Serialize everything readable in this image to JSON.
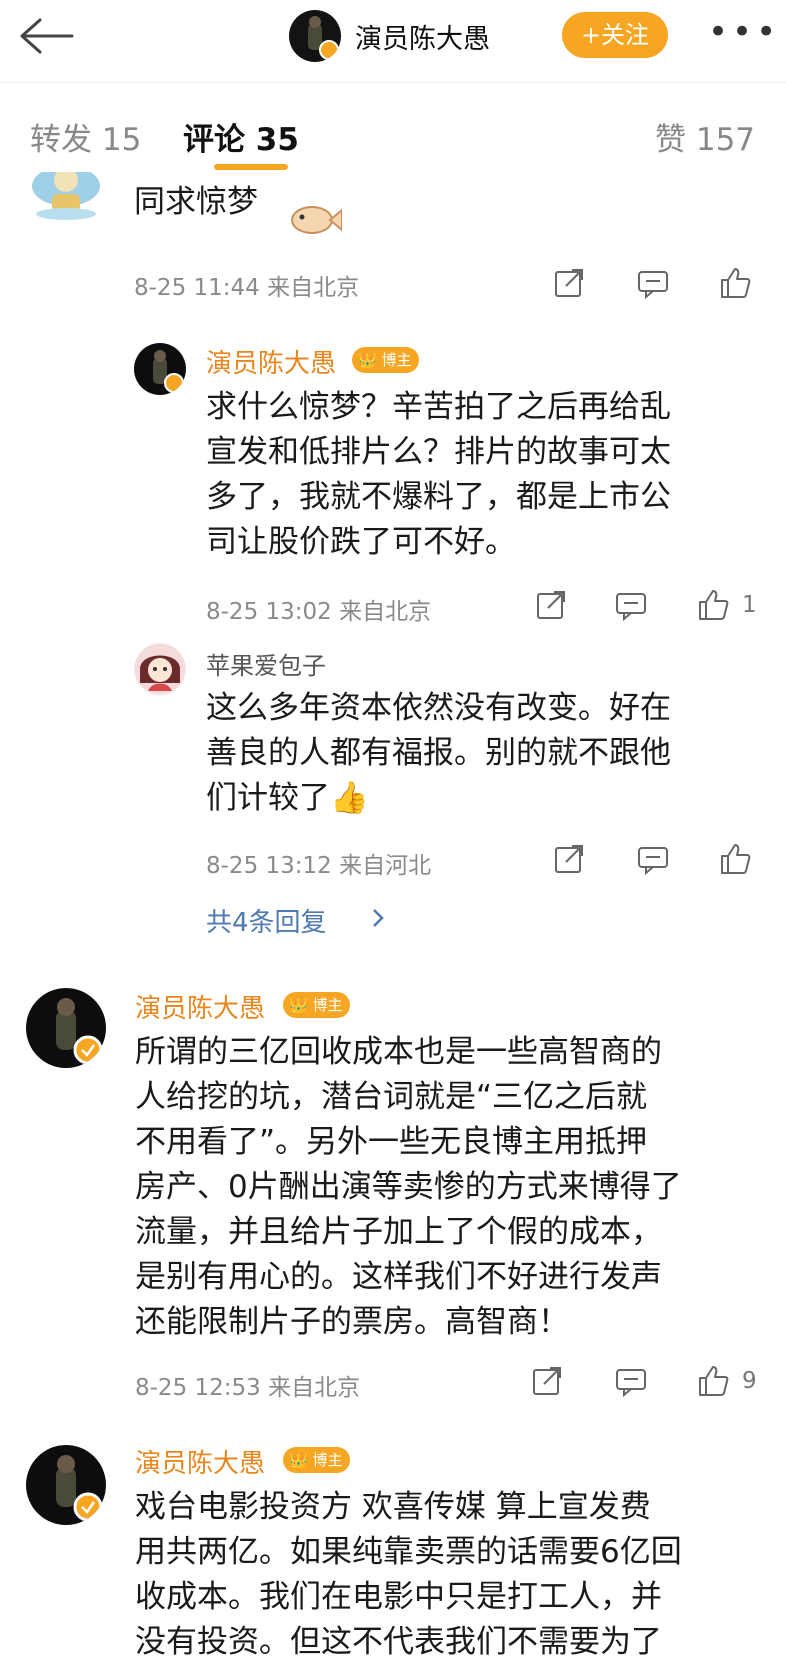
{
  "header": {
    "account_name": "演员陈大愚",
    "follow_label": "+关注",
    "more_label": "•••"
  },
  "tabs": [
    {
      "label": "转发",
      "count": "15"
    },
    {
      "label": "评论",
      "count": "35"
    },
    {
      "label": "赞",
      "count": "157"
    }
  ],
  "comments": [
    {
      "text": "同求惊梦",
      "time": "8-25 11:44",
      "location": "来自北京",
      "replies": [
        {
          "user": "演员陈大愚",
          "badge": "博主",
          "lines": [
            "求什么惊梦？辛苦拍了之后再给乱",
            "宣发和低排片么？排片的故事可太",
            "多了，我就不爆料了，都是上市公",
            "司让股价跌了可不好。"
          ],
          "time": "8-25 13:02",
          "location": "来自北京",
          "likes": "1"
        },
        {
          "user": "苹果爱包子",
          "lines": [
            "这么多年资本依然没有改变。好在",
            "善良的人都有福报。别的就不跟他",
            "们计较了👍"
          ],
          "time": "8-25 13:12",
          "location": "来自河北"
        }
      ],
      "more_replies": "共4条回复"
    },
    {
      "user": "演员陈大愚",
      "badge": "博主",
      "lines": [
        "所谓的三亿回收成本也是一些高智商的",
        "人给挖的坑，潜台词就是“三亿之后就",
        "不用看了”。另外一些无良博主用抵押",
        "房产、0片酬出演等卖惨的方式来博得了",
        "流量，并且给片子加上了个假的成本，",
        "是别有用心的。这样我们不好进行发声",
        "还能限制片子的票房。高智商！"
      ],
      "time": "8-25 12:53",
      "location": "来自北京",
      "likes": "9"
    },
    {
      "user": "演员陈大愚",
      "badge": "博主",
      "lines": [
        "戏台电影投资方  欢喜传媒  算上宣发费",
        "用共两亿。如果纯靠卖票的话需要6亿回",
        "收成本。我们在电影中只是打工人，并",
        "没有投资。但这不代表我们不需要为了"
      ]
    }
  ],
  "colors": {
    "accent": "#f6a623",
    "blogger_name": "#e8871e",
    "link": "#4f7bb0"
  },
  "icons": [
    "back-arrow-icon",
    "share-icon",
    "comment-icon",
    "like-icon",
    "chevron-right-icon",
    "verified-icon"
  ]
}
